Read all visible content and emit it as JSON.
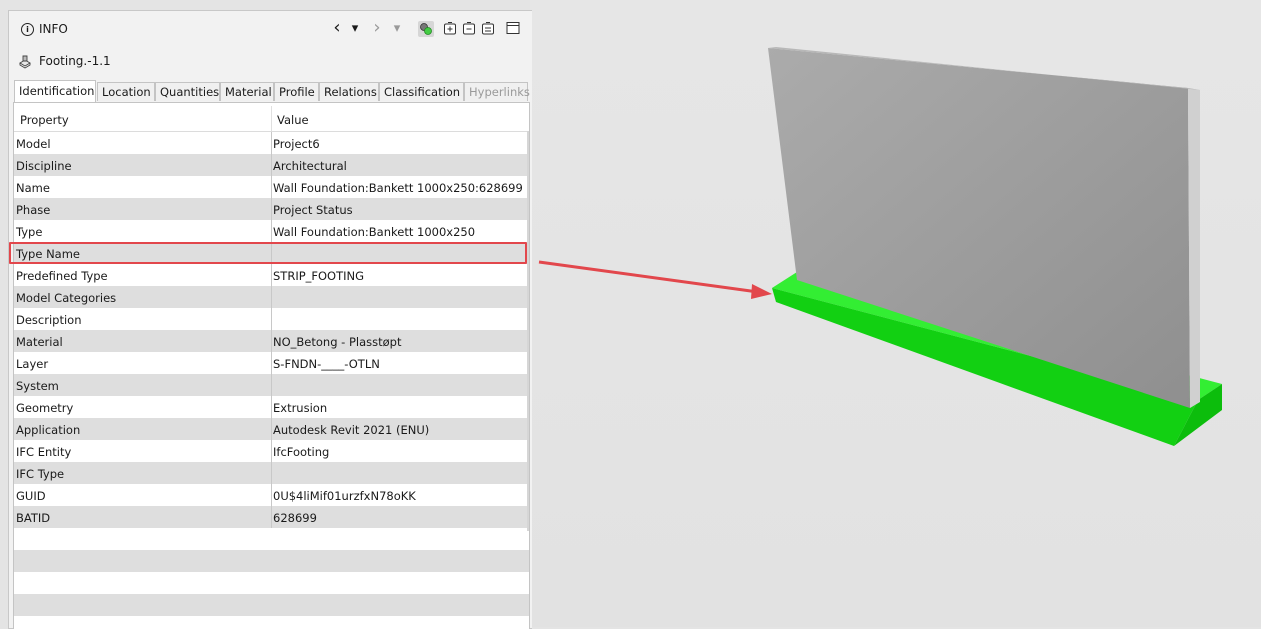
{
  "panel": {
    "title": "INFO",
    "info_icon_glyph": "i",
    "object_name": "Footing.-1.1",
    "toolbar": {
      "back_glyph": "‹",
      "back_menu_glyph": "▾",
      "forward_glyph": "›",
      "forward_menu_glyph": "▾",
      "icons": [
        "select-object-icon",
        "expand-all-icon",
        "collapse-icon",
        "clear-icon",
        "window-icon"
      ]
    }
  },
  "tabs": [
    {
      "label": "Identification",
      "active": true
    },
    {
      "label": "Location"
    },
    {
      "label": "Quantities"
    },
    {
      "label": "Material"
    },
    {
      "label": "Profile"
    },
    {
      "label": "Relations"
    },
    {
      "label": "Classification"
    },
    {
      "label": "Hyperlinks",
      "disabled": true
    }
  ],
  "table": {
    "headers": {
      "property": "Property",
      "value": "Value"
    },
    "rows": [
      {
        "property": "Model",
        "value": "Project6"
      },
      {
        "property": "Discipline",
        "value": "Architectural"
      },
      {
        "property": "Name",
        "value": "Wall Foundation:Bankett 1000x250:628699"
      },
      {
        "property": "Phase",
        "value": "Project Status"
      },
      {
        "property": "Type",
        "value": "Wall Foundation:Bankett 1000x250"
      },
      {
        "property": "Type Name",
        "value": ""
      },
      {
        "property": "Predefined Type",
        "value": "STRIP_FOOTING"
      },
      {
        "property": "Model Categories",
        "value": ""
      },
      {
        "property": "Description",
        "value": ""
      },
      {
        "property": "Material",
        "value": "NO_Betong - Plasstøpt"
      },
      {
        "property": "Layer",
        "value": "S-FNDN-____-OTLN"
      },
      {
        "property": "System",
        "value": ""
      },
      {
        "property": "Geometry",
        "value": "Extrusion"
      },
      {
        "property": "Application",
        "value": "Autodesk Revit 2021 (ENU)"
      },
      {
        "property": "IFC Entity",
        "value": "IfcFooting"
      },
      {
        "property": "IFC Type",
        "value": ""
      },
      {
        "property": "GUID",
        "value": "0U$4liMif01urzfxN78oKK"
      },
      {
        "property": "BATID",
        "value": "628699"
      }
    ]
  },
  "colors": {
    "footing_green": "#1ee11e",
    "wall_gray": "#a8a8a8",
    "annotation_red": "#e2474c"
  }
}
